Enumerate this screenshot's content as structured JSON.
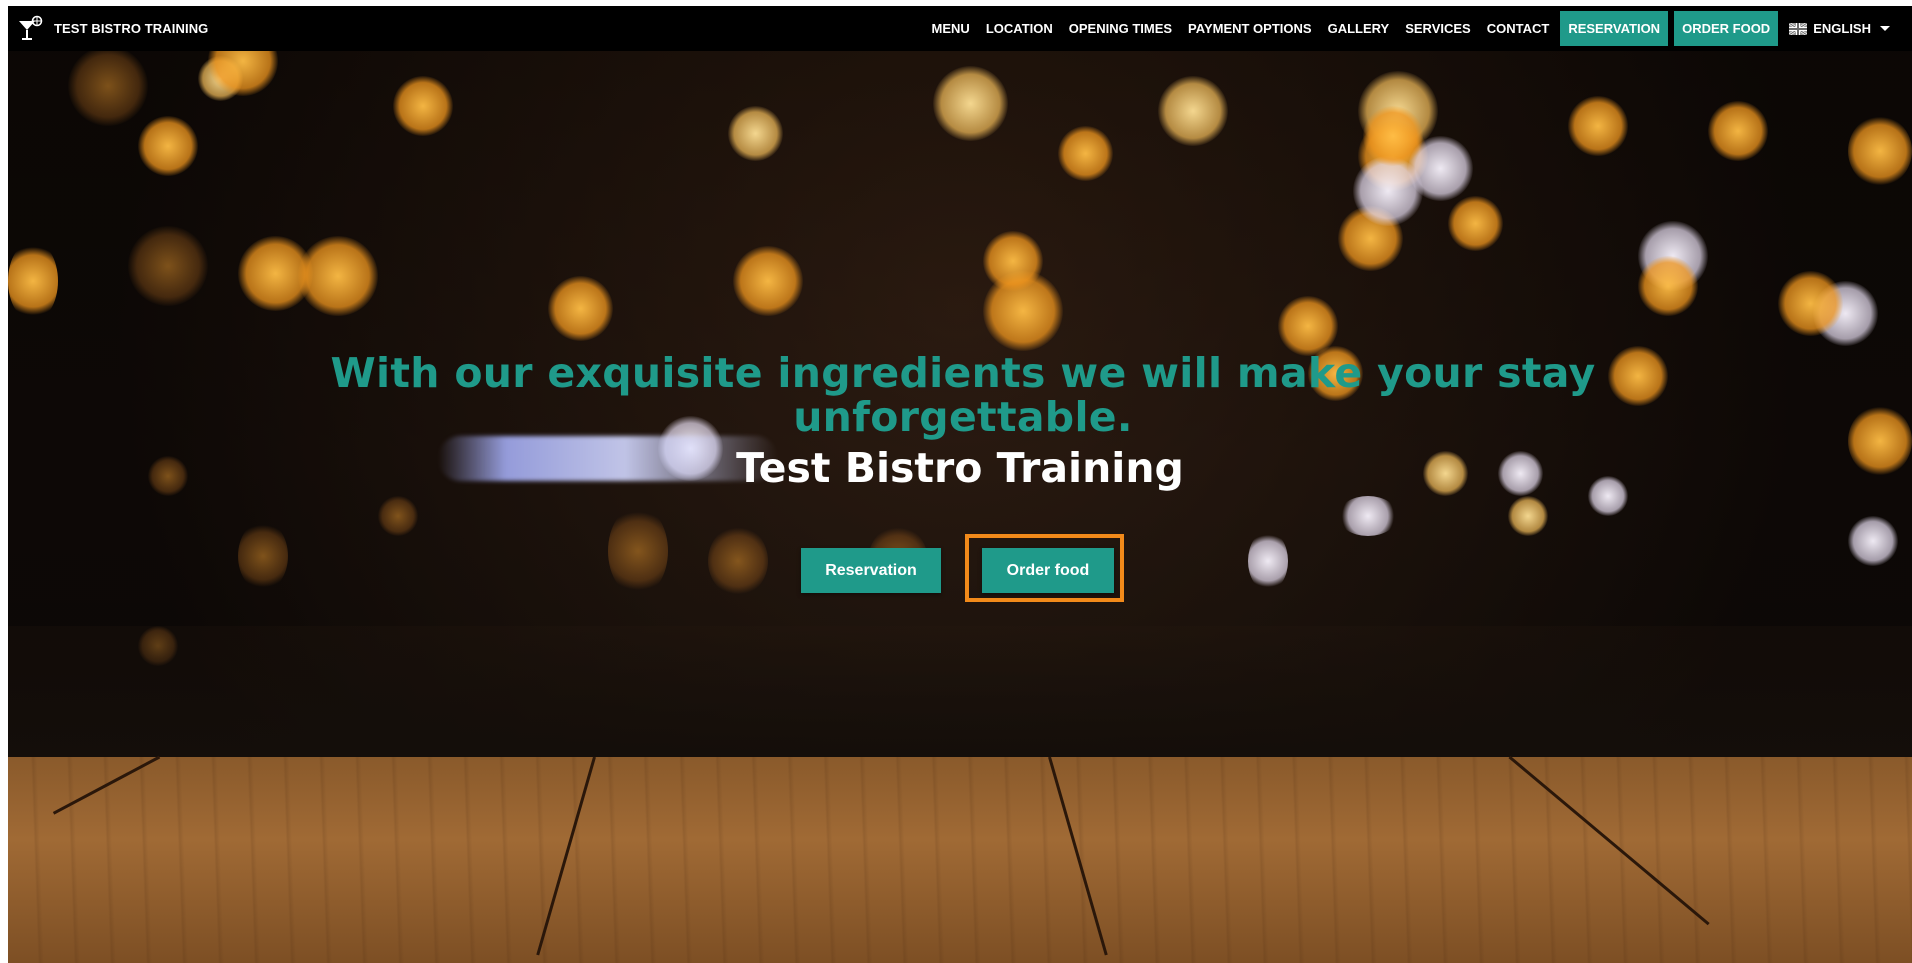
{
  "navbar": {
    "brand_name": "TEST BISTRO TRAINING",
    "brand_icon": "cocktail-glass-icon",
    "links": [
      {
        "label": "MENU"
      },
      {
        "label": "LOCATION"
      },
      {
        "label": "OPENING TIMES"
      },
      {
        "label": "PAYMENT OPTIONS"
      },
      {
        "label": "GALLERY"
      },
      {
        "label": "SERVICES"
      },
      {
        "label": "CONTACT"
      }
    ],
    "reservation_label": "RESERVATION",
    "order_food_label": "ORDER FOOD",
    "language": {
      "label": "ENGLISH",
      "flag_icon": "uk-flag-icon",
      "caret_icon": "caret-down-icon"
    }
  },
  "hero": {
    "headline": "With our exquisite ingredients we will make your stay unforgettable.",
    "subtitle": "Test Bistro Training",
    "reservation_button": "Reservation",
    "order_food_button": "Order food"
  },
  "colors": {
    "accent": "#1f9a8a",
    "highlight": "#f28a1a",
    "navbar_bg": "#000000"
  }
}
